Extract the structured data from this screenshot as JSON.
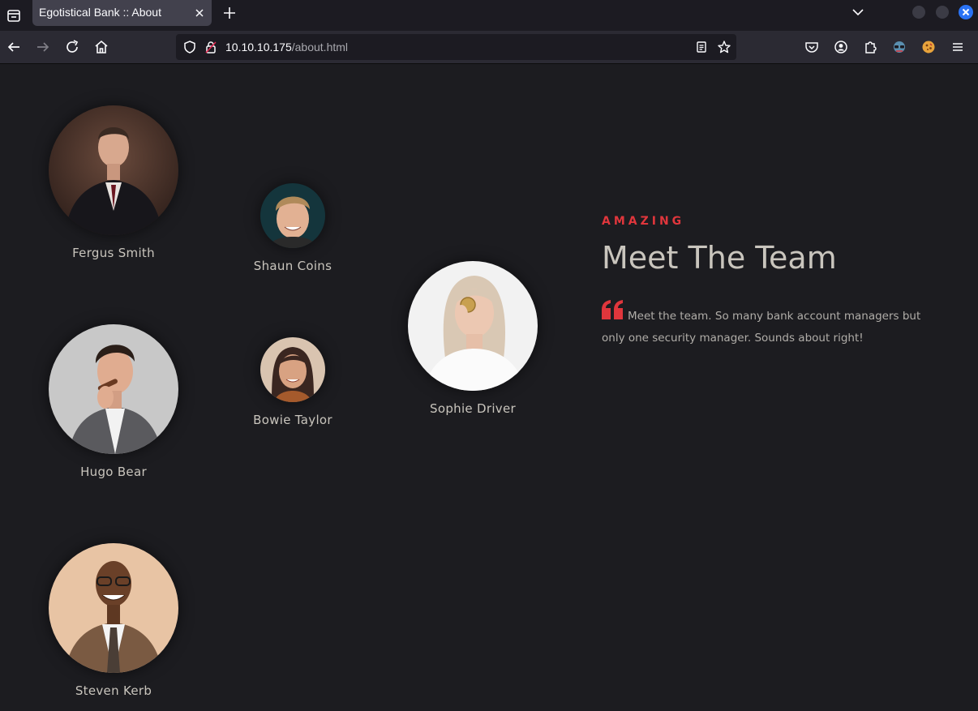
{
  "browser": {
    "tab_title": "Egotistical Bank :: About",
    "url_host": "10.10.10.175",
    "url_path": "/about.html",
    "accent": "#2a73f5"
  },
  "page": {
    "eyebrow": "AMAZING",
    "heading": "Meet The Team",
    "quote": "Meet the team. So many bank account managers but only one security manager. Sounds about right!",
    "accent": "#e0363c"
  },
  "team": [
    {
      "name": "Fergus Smith"
    },
    {
      "name": "Shaun Coins"
    },
    {
      "name": "Hugo Bear"
    },
    {
      "name": "Bowie Taylor"
    },
    {
      "name": "Sophie Driver"
    },
    {
      "name": "Steven Kerb"
    }
  ]
}
